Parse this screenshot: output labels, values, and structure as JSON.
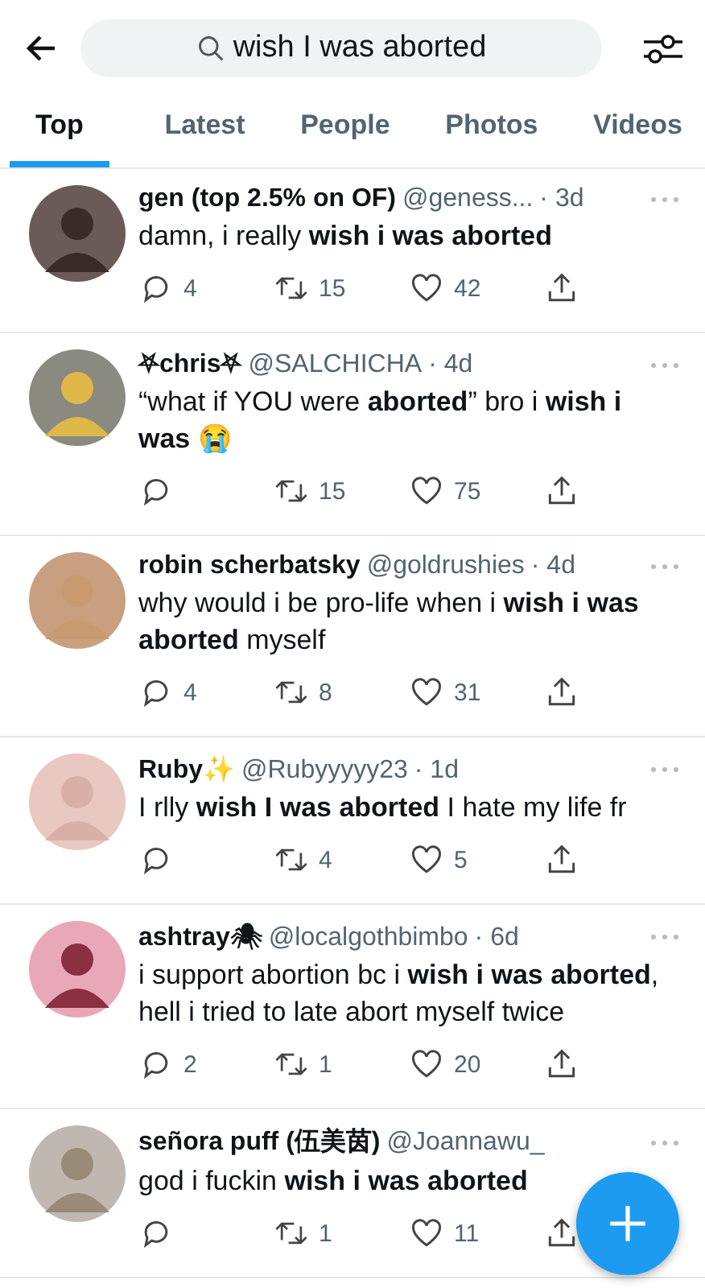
{
  "search": {
    "value": "wish I was aborted"
  },
  "tabs": [
    {
      "label": "Top",
      "selected": true
    },
    {
      "label": "Latest",
      "selected": false
    },
    {
      "label": "People",
      "selected": false
    },
    {
      "label": "Photos",
      "selected": false
    },
    {
      "label": "Videos",
      "selected": false
    }
  ],
  "tweets": [
    {
      "name": "gen (top 2.5% on OF)",
      "handle": "@geness...",
      "time": "· 3d",
      "text": "damn, i really **wish i was aborted**",
      "replies": "4",
      "retweets": "15",
      "likes": "42"
    },
    {
      "name": "⛧chris⛧",
      "handle": "@SALCHICHA",
      "time": "· 4d",
      "text": "“what if YOU were **aborted**” bro i **wish i was** 😭",
      "retweets": "15",
      "likes": "75"
    },
    {
      "name": "robin scherbatsky",
      "handle": "@goldrushies",
      "time": "· 4d",
      "text": "why would i be pro-life when i **wish i was aborted** myself",
      "replies": "4",
      "retweets": "8",
      "likes": "31"
    },
    {
      "name": "Ruby✨",
      "handle": "@Rubyyyyy23",
      "time": "· 1d",
      "text": "I rlly **wish I was aborted** I hate my life fr",
      "retweets": "4",
      "likes": "5"
    },
    {
      "name": "ashtray🕷",
      "handle": "@localgothbimbo",
      "time": "· 6d",
      "text": "i support abortion bc i **wish i was aborted**, hell i tried to late abort myself twice",
      "replies": "2",
      "retweets": "1",
      "likes": "20"
    },
    {
      "name": "señora puff (伍美茵)",
      "handle": "@Joannawu_",
      "text": "god i fuckin **wish i was aborted**",
      "retweets": "1",
      "likes": "11"
    }
  ]
}
